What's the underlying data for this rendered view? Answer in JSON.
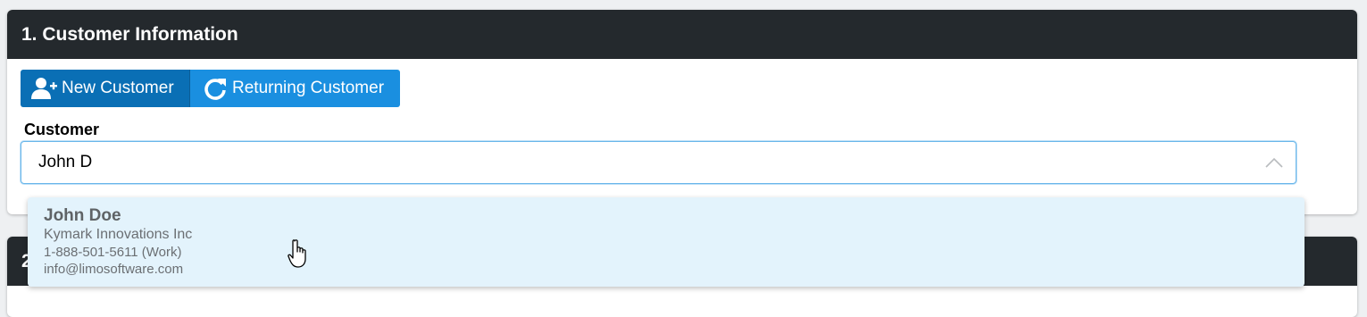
{
  "panels": {
    "customer_info": {
      "title": "1. Customer Information"
    },
    "section_2": {
      "title": "2"
    }
  },
  "buttons": {
    "new_customer": {
      "label": "New Customer",
      "icon": "add-user-icon"
    },
    "returning_customer": {
      "label": "Returning Customer",
      "icon": "refresh-icon"
    }
  },
  "customer_field": {
    "label": "Customer",
    "value": "John D",
    "toggle_icon": "chevron-up-icon"
  },
  "dropdown": {
    "options": [
      {
        "name": "John Doe",
        "company": "Kymark Innovations Inc",
        "phone": "1-888-501-5611 (Work)",
        "email": "info@limosoftware.com"
      }
    ]
  },
  "colors": {
    "header_bg": "#24292d",
    "btn_primary_dark": "#0a6fb5",
    "btn_primary": "#1a8fe0",
    "focus_border": "#69b6ea",
    "option_hover_bg": "#e3f3fc"
  }
}
